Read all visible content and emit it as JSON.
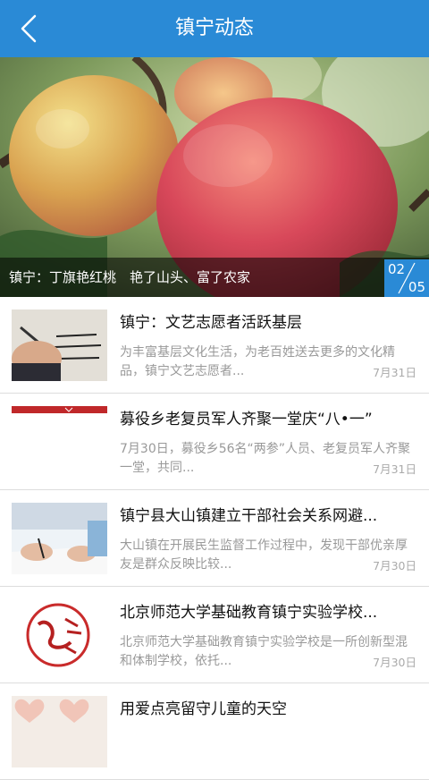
{
  "header": {
    "title": "镇宁动态",
    "back_icon": "chevron-left-icon",
    "color": "#2a8ad6"
  },
  "banner": {
    "caption": "镇宁：丁旗艳红桃　艳了山头、富了农家",
    "page_current": "02",
    "page_total": "05"
  },
  "news": [
    {
      "title": "镇宁：文艺志愿者活跃基层",
      "summary": "为丰富基层文化生活，为老百姓送去更多的文化精品，镇宁文艺志愿者...",
      "date": "7月31日"
    },
    {
      "title": "募役乡老复员军人齐聚一堂庆“八•一”",
      "summary": "7月30日，募役乡56名“两参”人员、老复员军人齐聚一堂，共同...",
      "date": "7月31日"
    },
    {
      "title": "镇宁县大山镇建立干部社会关系网避...",
      "summary": "大山镇在开展民生监督工作过程中，发现干部优亲厚友是群众反映比较...",
      "date": "7月30日"
    },
    {
      "title": "北京师范大学基础教育镇宁实验学校...",
      "summary": "北京师范大学基础教育镇宁实验学校是一所创新型混和体制学校，依托...",
      "date": "7月30日"
    },
    {
      "title": "用爱点亮留守儿童的天空",
      "summary": "",
      "date": ""
    }
  ]
}
